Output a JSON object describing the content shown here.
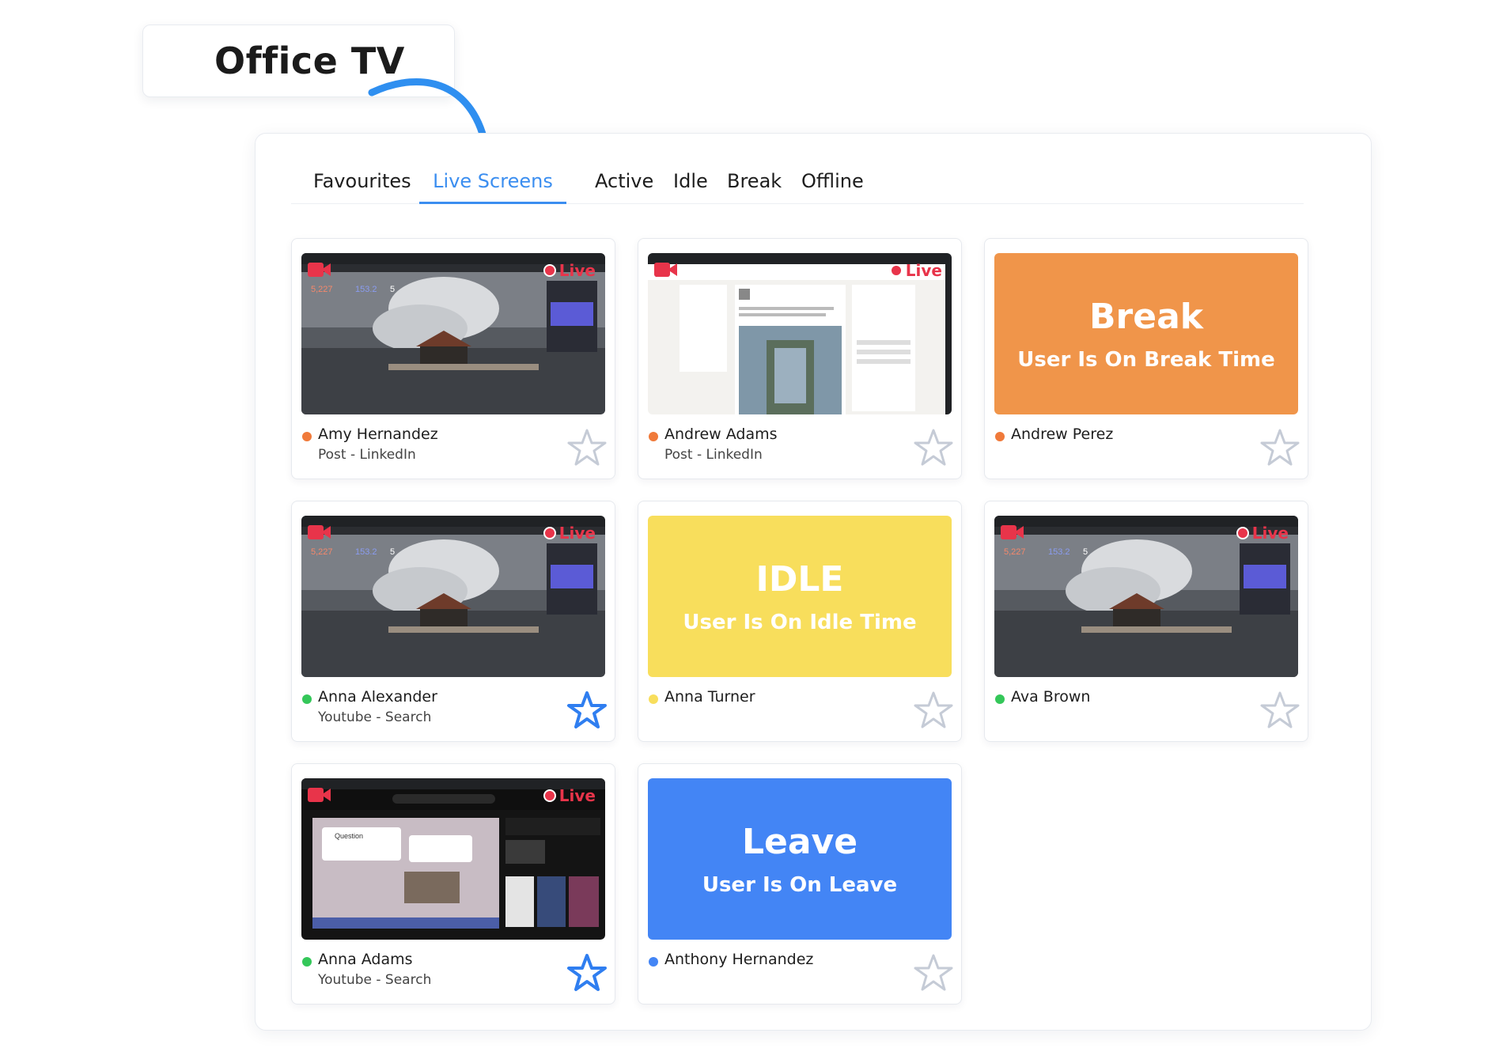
{
  "header": {
    "title": "Office TV"
  },
  "tabs": [
    {
      "label": "Favourites",
      "active": false
    },
    {
      "label": "Live Screens",
      "active": true
    },
    {
      "label": "Active",
      "active": false
    },
    {
      "label": "Idle",
      "active": false
    },
    {
      "label": "Break",
      "active": false
    },
    {
      "label": "Offline",
      "active": false
    }
  ],
  "live_label": "Live",
  "colors": {
    "accent": "#3b8ef0",
    "break": "#f0954a",
    "idle": "#f8de5c",
    "leave": "#4385f5",
    "status_orange": "#f07a3a",
    "status_green": "#34c759",
    "status_yellow": "#f8de5c",
    "status_blue": "#4385f5",
    "live_red": "#e8344a"
  },
  "cards": [
    {
      "name": "Amy Hernandez",
      "activity": "Post - LinkedIn",
      "status_color": "orange",
      "screen": "live-desktop",
      "favourite": false
    },
    {
      "name": "Andrew Adams",
      "activity": "Post - LinkedIn",
      "status_color": "orange",
      "screen": "live-linkedin",
      "favourite": false
    },
    {
      "name": "Andrew Perez",
      "activity": "",
      "status_color": "orange",
      "screen": "break",
      "status_title": "Break",
      "status_sub": "User Is On Break Time",
      "favourite": false
    },
    {
      "name": "Anna Alexander",
      "activity": "Youtube - Search",
      "status_color": "green",
      "screen": "live-desktop",
      "favourite": true
    },
    {
      "name": "Anna Turner",
      "activity": "",
      "status_color": "yellow",
      "screen": "idle",
      "status_title": "IDLE",
      "status_sub": "User Is On Idle Time",
      "favourite": false
    },
    {
      "name": "Ava Brown",
      "activity": "",
      "status_color": "green",
      "screen": "live-desktop",
      "favourite": false
    },
    {
      "name": "Anna Adams",
      "activity": "Youtube - Search",
      "status_color": "green",
      "screen": "live-youtube",
      "favourite": true
    },
    {
      "name": "Anthony Hernandez",
      "activity": "",
      "status_color": "blue",
      "screen": "leave",
      "status_title": "Leave",
      "status_sub": "User Is On Leave",
      "favourite": false
    }
  ]
}
